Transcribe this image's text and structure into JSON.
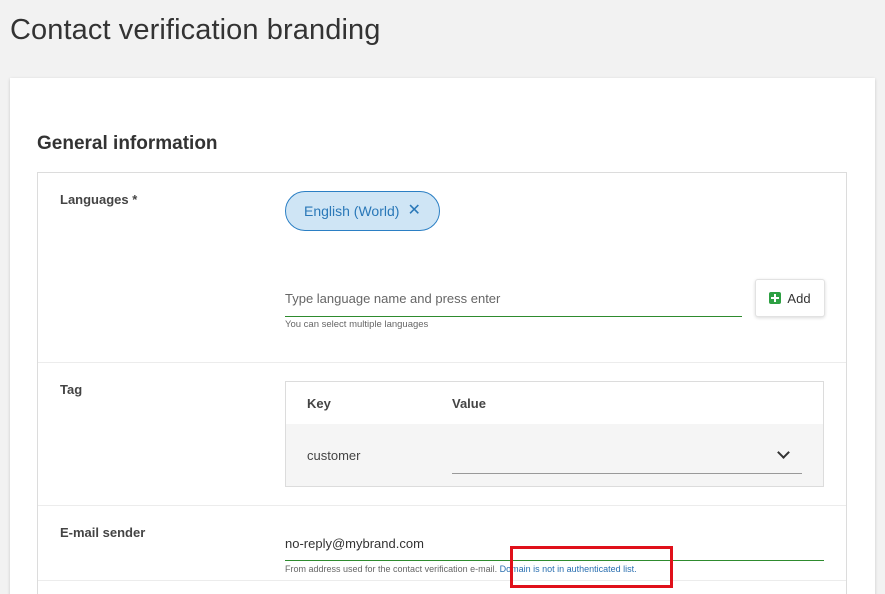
{
  "page": {
    "title": "Contact verification branding"
  },
  "section": {
    "title": "General information"
  },
  "languages": {
    "label": "Languages *",
    "chip": "English (World)",
    "input_placeholder": "Type language name and press enter",
    "hint": "You can select multiple languages",
    "add_label": "Add"
  },
  "tag": {
    "label": "Tag",
    "columns": {
      "key": "Key",
      "value": "Value"
    },
    "row": {
      "key": "customer",
      "value": ""
    }
  },
  "email": {
    "label": "E-mail sender",
    "value": "no-reply@mybrand.com",
    "hint": "From address used for the contact verification e-mail.",
    "warning": "Domain is not in authenticated list."
  }
}
